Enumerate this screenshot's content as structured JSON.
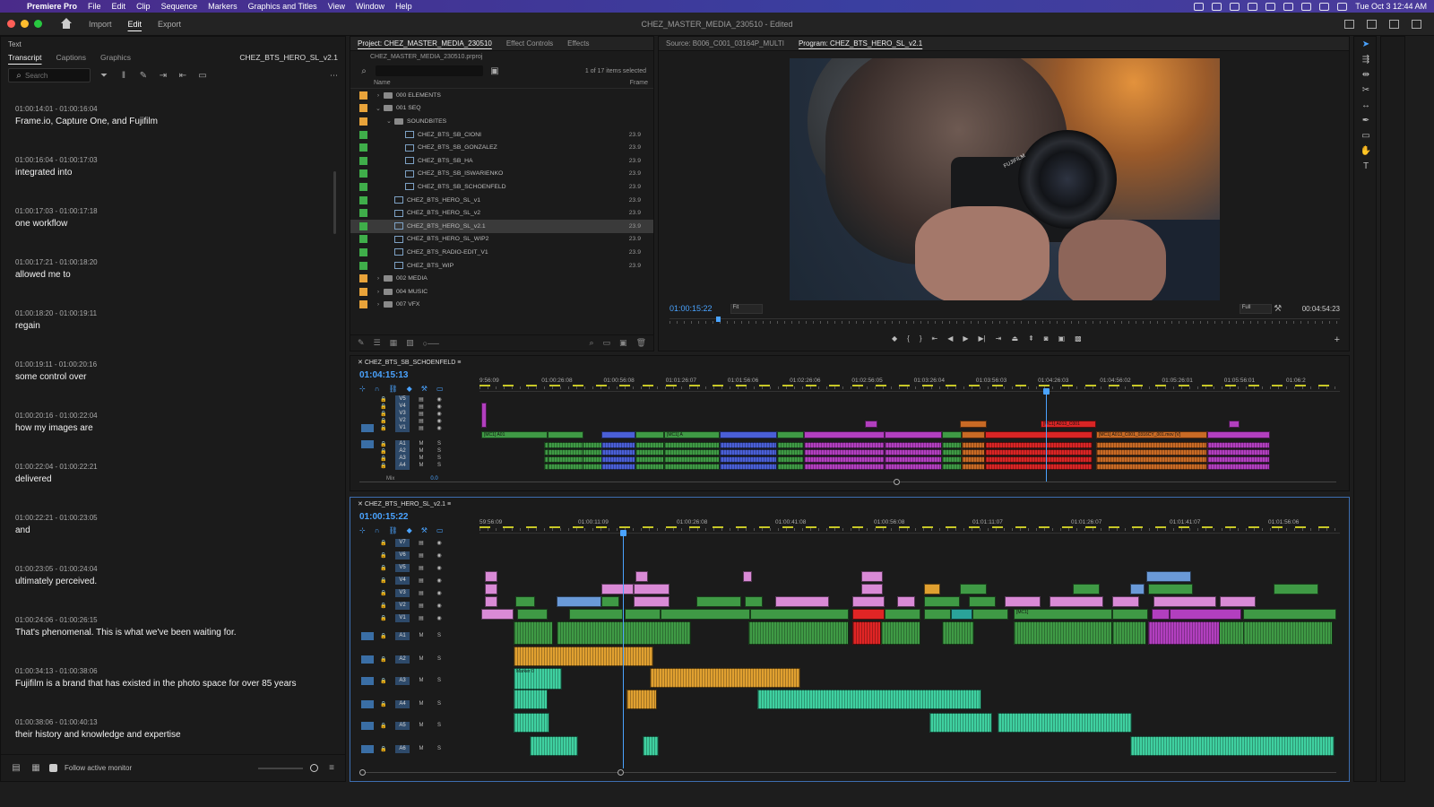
{
  "menubar": {
    "app_name": "Premiere Pro",
    "items": [
      "File",
      "Edit",
      "Clip",
      "Sequence",
      "Markers",
      "Graphics and Titles",
      "View",
      "Window",
      "Help"
    ],
    "clock": "Tue Oct 3  12:44 AM"
  },
  "header": {
    "workspaces": [
      "Import",
      "Edit",
      "Export"
    ],
    "active_workspace": "Edit",
    "document_title": "CHEZ_MASTER_MEDIA_230510 - Edited"
  },
  "text_panel": {
    "title": "Text",
    "tabs": [
      "Transcript",
      "Captions",
      "Graphics"
    ],
    "active_tab": "Transcript",
    "sequence_name": "CHEZ_BTS_HERO_SL_v2.1",
    "search_placeholder": "Search",
    "segments": [
      {
        "tc": "01:00:14:01 - 01:00:16:04",
        "text": "Frame.io, Capture One, and Fujifilm"
      },
      {
        "tc": "01:00:16:04 - 01:00:17:03",
        "text": "integrated into"
      },
      {
        "tc": "01:00:17:03 - 01:00:17:18",
        "text": "one workflow"
      },
      {
        "tc": "01:00:17:21 - 01:00:18:20",
        "text": "allowed me to"
      },
      {
        "tc": "01:00:18:20 - 01:00:19:11",
        "text": "regain"
      },
      {
        "tc": "01:00:19:11 - 01:00:20:16",
        "text": "some control over"
      },
      {
        "tc": "01:00:20:16 - 01:00:22:04",
        "text": "how my images are"
      },
      {
        "tc": "01:00:22:04 - 01:00:22:21",
        "text": "delivered"
      },
      {
        "tc": "01:00:22:21 - 01:00:23:05",
        "text": "and"
      },
      {
        "tc": "01:00:23:05 - 01:00:24:04",
        "text": "ultimately perceived."
      },
      {
        "tc": "01:00:24:06 - 01:00:26:15",
        "text": "That's phenomenal. This is what we've been waiting for."
      },
      {
        "tc": "01:00:34:13 - 01:00:38:06",
        "text": "Fujifilm is a brand that has existed in the photo space for over 85 years"
      },
      {
        "tc": "01:00:38:06 - 01:00:40:13",
        "text": "their history and knowledge and expertise"
      }
    ],
    "follow_monitor_label": "Follow active monitor"
  },
  "project_panel": {
    "tabs": [
      "Project: CHEZ_MASTER_MEDIA_230510",
      "Effect Controls",
      "Effects"
    ],
    "path": "CHEZ_MASTER_MEDIA_230510.prproj",
    "count": "1 of 17 items selected",
    "col_name": "Name",
    "col_frame": "Frame",
    "rows": [
      {
        "name": "000 ELEMENTS",
        "type": "folder",
        "color": "#e8a33a",
        "indent": 0,
        "caret": "›",
        "fr": ""
      },
      {
        "name": "001 SEQ",
        "type": "folder",
        "color": "#e8a33a",
        "indent": 0,
        "caret": "⌄",
        "fr": ""
      },
      {
        "name": "SOUNDBITES",
        "type": "folder",
        "color": "#e8a33a",
        "indent": 1,
        "caret": "⌄",
        "fr": ""
      },
      {
        "name": "CHEZ_BTS_SB_CIONI",
        "type": "seq",
        "color": "#3fae4a",
        "indent": 2,
        "caret": "",
        "fr": "23.9"
      },
      {
        "name": "CHEZ_BTS_SB_GONZALEZ",
        "type": "seq",
        "color": "#3fae4a",
        "indent": 2,
        "caret": "",
        "fr": "23.9"
      },
      {
        "name": "CHEZ_BTS_SB_HA",
        "type": "seq",
        "color": "#3fae4a",
        "indent": 2,
        "caret": "",
        "fr": "23.9"
      },
      {
        "name": "CHEZ_BTS_SB_ISWARIENKO",
        "type": "seq",
        "color": "#3fae4a",
        "indent": 2,
        "caret": "",
        "fr": "23.9"
      },
      {
        "name": "CHEZ_BTS_SB_SCHOENFELD",
        "type": "seq",
        "color": "#3fae4a",
        "indent": 2,
        "caret": "",
        "fr": "23.9"
      },
      {
        "name": "CHEZ_BTS_HERO_SL_v1",
        "type": "seq",
        "color": "#3fae4a",
        "indent": 1,
        "caret": "",
        "fr": "23.9"
      },
      {
        "name": "CHEZ_BTS_HERO_SL_v2",
        "type": "seq",
        "color": "#3fae4a",
        "indent": 1,
        "caret": "",
        "fr": "23.9"
      },
      {
        "name": "CHEZ_BTS_HERO_SL_v2.1",
        "type": "seq",
        "color": "#3fae4a",
        "indent": 1,
        "caret": "",
        "fr": "23.9",
        "selected": true
      },
      {
        "name": "CHEZ_BTS_HERO_SL_WIP2",
        "type": "seq",
        "color": "#3fae4a",
        "indent": 1,
        "caret": "",
        "fr": "23.9"
      },
      {
        "name": "CHEZ_BTS_RADIO-EDIT_V1",
        "type": "seq",
        "color": "#3fae4a",
        "indent": 1,
        "caret": "",
        "fr": "23.9"
      },
      {
        "name": "CHEZ_BTS_WIP",
        "type": "seq",
        "color": "#3fae4a",
        "indent": 1,
        "caret": "",
        "fr": "23.9"
      },
      {
        "name": "002 MEDIA",
        "type": "folder",
        "color": "#e8a33a",
        "indent": 0,
        "caret": "›",
        "fr": ""
      },
      {
        "name": "004 MUSIC",
        "type": "folder",
        "color": "#e8a33a",
        "indent": 0,
        "caret": "›",
        "fr": ""
      },
      {
        "name": "007 VFX",
        "type": "folder",
        "color": "#e8a33a",
        "indent": 0,
        "caret": "›",
        "fr": ""
      }
    ]
  },
  "monitor": {
    "source_tab": "Source: B006_C001_03164P_MULTI",
    "program_tab": "Program: CHEZ_BTS_HERO_SL_v2.1",
    "brand_on_camera": "FUJIFILM",
    "timecode": "01:00:15:22",
    "fit": "Fit",
    "quality": "Full",
    "duration": "00:04:54:23",
    "playhead_fraction": 0.07
  },
  "timeline1": {
    "name": "CHEZ_BTS_SB_SCHOENFELD",
    "timecode": "01:04:15:13",
    "ticks": [
      "9:56:09",
      "01:00:26:08",
      "01:00:56:08",
      "01:01:26:07",
      "01:01:56:06",
      "01:02:26:06",
      "01:02:56:05",
      "01:03:26:04",
      "01:03:56:03",
      "01:04:26:03",
      "01:04:56:02",
      "01:05:26:01",
      "01:05:56:01",
      "01:06:2"
    ],
    "video_tracks": [
      "V5",
      "V4",
      "V3",
      "V2",
      "V1"
    ],
    "audio_tracks": [
      "A1",
      "A2",
      "A3",
      "A4"
    ],
    "mix_label": "Mix",
    "mix_value": "0.0",
    "clip_labels": {
      "mc1_a01": "[MC1] A01",
      "mc1_a": "[MC1] A",
      "red_clip": "[MC1] A013_C001",
      "long_clip": "[MC1] A013_C001_0316CY_001.mov [V]"
    }
  },
  "timeline2": {
    "name": "CHEZ_BTS_HERO_SL_v2.1",
    "timecode": "01:00:15:22",
    "ticks": [
      "59:56:09",
      "01:00:11:09",
      "01:00:26:08",
      "01:00:41:08",
      "01:00:56:08",
      "01:01:11:07",
      "01:01:26:07",
      "01:01:41:07",
      "01:01:56:06"
    ],
    "video_tracks": [
      "V7",
      "V6",
      "V5",
      "V4",
      "V3",
      "V2",
      "V1"
    ],
    "audio_tracks": [
      "A1",
      "A2",
      "A3",
      "A4",
      "A5",
      "A6"
    ],
    "marker_label": "Marker 0",
    "mc_label": "[MC1]"
  }
}
